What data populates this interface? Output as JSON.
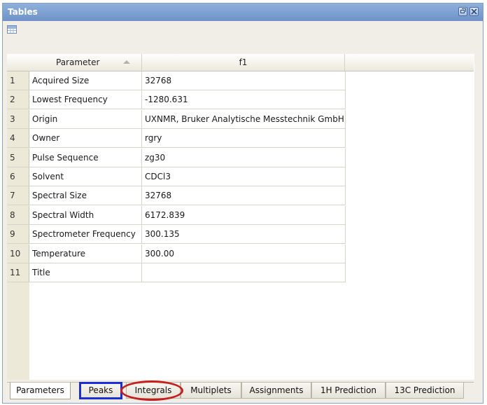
{
  "window": {
    "title": "Tables"
  },
  "table": {
    "headers": {
      "parameter": "Parameter",
      "f1": "f1"
    },
    "rows": [
      {
        "num": "1",
        "parameter": "Acquired Size",
        "value": "32768"
      },
      {
        "num": "2",
        "parameter": "Lowest Frequency",
        "value": "-1280.631"
      },
      {
        "num": "3",
        "parameter": "Origin",
        "value": "UXNMR, Bruker Analytische Messtechnik GmbH"
      },
      {
        "num": "4",
        "parameter": "Owner",
        "value": "rgry"
      },
      {
        "num": "5",
        "parameter": "Pulse Sequence",
        "value": "zg30"
      },
      {
        "num": "6",
        "parameter": "Solvent",
        "value": "CDCl3"
      },
      {
        "num": "7",
        "parameter": "Spectral Size",
        "value": "32768"
      },
      {
        "num": "8",
        "parameter": "Spectral Width",
        "value": "6172.839"
      },
      {
        "num": "9",
        "parameter": "Spectrometer Frequency",
        "value": "300.135"
      },
      {
        "num": "10",
        "parameter": "Temperature",
        "value": "300.00"
      },
      {
        "num": "11",
        "parameter": "Title",
        "value": ""
      }
    ]
  },
  "tabs": [
    {
      "label": "Parameters",
      "active": true
    },
    {
      "label": "Peaks",
      "active": false
    },
    {
      "label": "Integrals",
      "active": false
    },
    {
      "label": "Multiplets",
      "active": false
    },
    {
      "label": "Assignments",
      "active": false
    },
    {
      "label": "1H Prediction",
      "active": false
    },
    {
      "label": "13C Prediction",
      "active": false
    }
  ],
  "annotations": {
    "box_color": "#1d2fd4",
    "oval_color": "#c71d1d"
  }
}
